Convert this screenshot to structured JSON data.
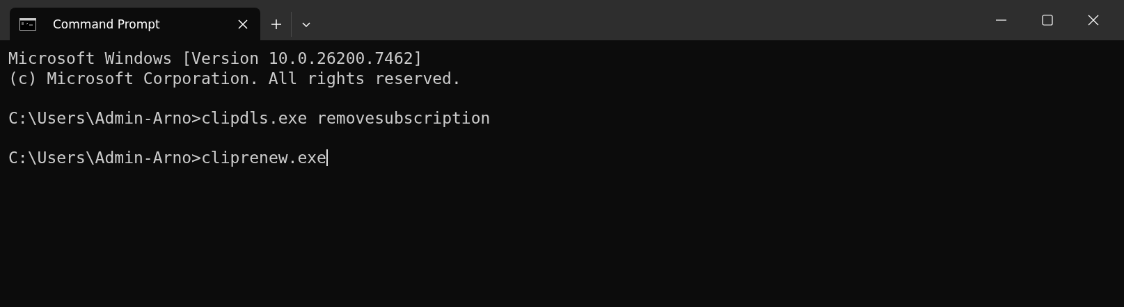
{
  "tabs": [
    {
      "title": "Command Prompt",
      "selected": true
    }
  ],
  "terminal": {
    "lines": [
      {
        "kind": "output",
        "text": "Microsoft Windows [Version 10.0.26200.7462]"
      },
      {
        "kind": "output",
        "text": "(c) Microsoft Corporation. All rights reserved."
      },
      {
        "kind": "prompt",
        "prompt": "C:\\Users\\Admin-Arno>",
        "command": "clipdls.exe removesubscription",
        "cursor": false
      },
      {
        "kind": "prompt",
        "prompt": "C:\\Users\\Admin-Arno>",
        "command": "cliprenew.exe",
        "cursor": true
      }
    ]
  }
}
